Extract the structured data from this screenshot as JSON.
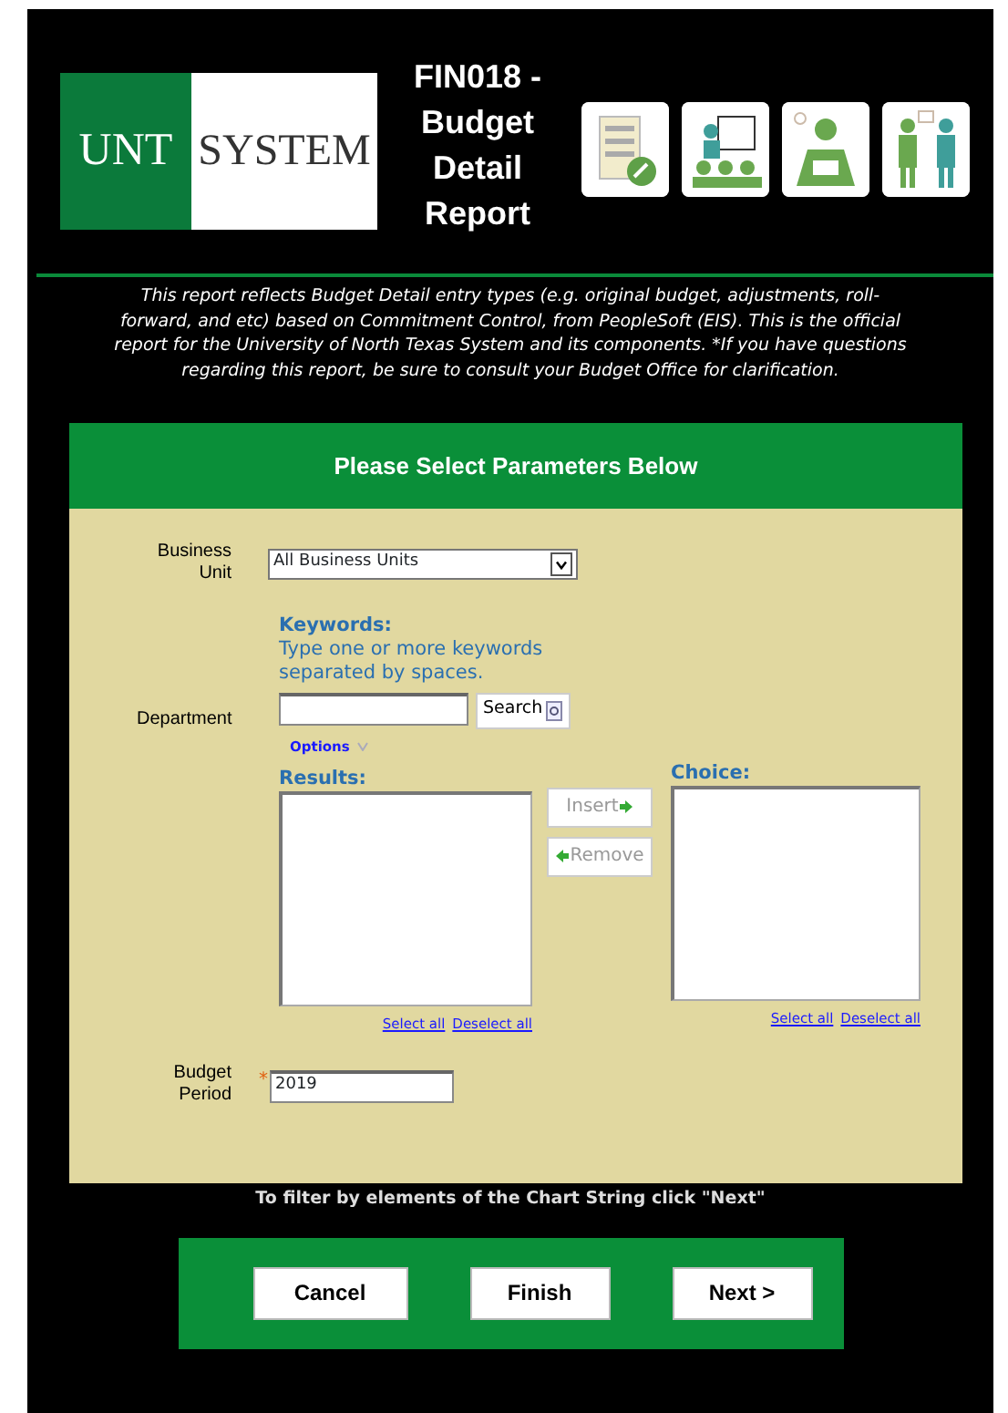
{
  "header": {
    "logo": {
      "left": "UNT",
      "right": "SYSTEM"
    },
    "title": "FIN018 - Budget Detail Report"
  },
  "description": "This report reflects Budget Detail entry types (e.g. original budget, adjustments, roll-forward, and etc) based on Commitment Control, from PeopleSoft (EIS). This is the official report for the University of North Texas System and its components. *If you have questions regarding this report, be sure to consult your Budget Office for clarification.",
  "panel": {
    "title": "Please Select Parameters Below",
    "business_unit": {
      "label": "Business Unit",
      "value": "All Business Units"
    },
    "department": {
      "label": "Department",
      "keywords_title": "Keywords:",
      "keywords_hint": "Type one or more keywords separated by spaces.",
      "search_button": "Search",
      "options_link": "Options",
      "results_label": "Results:",
      "choice_label": "Choice:",
      "move_buttons": [
        {
          "label": "Insert",
          "kind": "insert",
          "disabled": true
        },
        {
          "label": "Remove",
          "kind": "remove",
          "disabled": true
        }
      ],
      "results_links": [
        "Select all",
        "Deselect all"
      ],
      "choice_links": [
        "Select all",
        "Deselect all"
      ]
    },
    "budget_period": {
      "label": "Budget Period",
      "required_mark": "*",
      "value": "2019"
    }
  },
  "footer_note": "To filter by elements of the Chart String click \"Next\"",
  "buttons": [
    "Cancel",
    "Finish",
    "Next >"
  ]
}
